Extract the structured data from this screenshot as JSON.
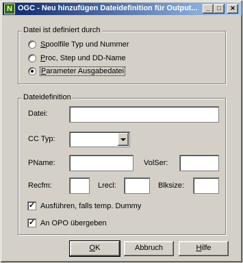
{
  "window": {
    "title": "OGC - Neu hinzufügen Dateidefinition für Output...",
    "icon_letter": "N",
    "minimize_glyph": "_",
    "maximize_glyph": "□",
    "close_glyph": "✕"
  },
  "source_group": {
    "label": "Datei ist definiert durch",
    "options": [
      {
        "label_pre": "",
        "label_key": "S",
        "label_post": "poolfile Typ und Nummer",
        "checked": false
      },
      {
        "label_pre": "",
        "label_key": "P",
        "label_post": "roc, Step und DD-Name",
        "checked": false
      },
      {
        "label_pre": "",
        "label_key": "P",
        "label_post": "arameter Ausgabedatei",
        "checked": true
      }
    ]
  },
  "definition_group": {
    "label": "Dateidefinition",
    "datei_label": "Datei:",
    "datei_value": "",
    "cc_typ_label": "CC Typ:",
    "cc_typ_value": "",
    "pname_label": "PName:",
    "pname_value": "",
    "volser_label": "VolSer:",
    "volser_value": "",
    "recfm_label": "Recfm:",
    "recfm_value": "",
    "lrecl_label": "Lrecl:",
    "lrecl_value": "",
    "blksize_label": "Blksize:",
    "blksize_value": "",
    "dummy_check_label": "Ausführen, falls temp. Dummy",
    "dummy_checked": true,
    "opo_check_label": "An OPO übergeben",
    "opo_checked": true
  },
  "buttons": {
    "ok_pre": "",
    "ok_key": "O",
    "ok_post": "K",
    "cancel_label": "Abbruch",
    "help_pre": "",
    "help_key": "H",
    "help_post": "ilfe"
  },
  "check_glyph": "✓"
}
